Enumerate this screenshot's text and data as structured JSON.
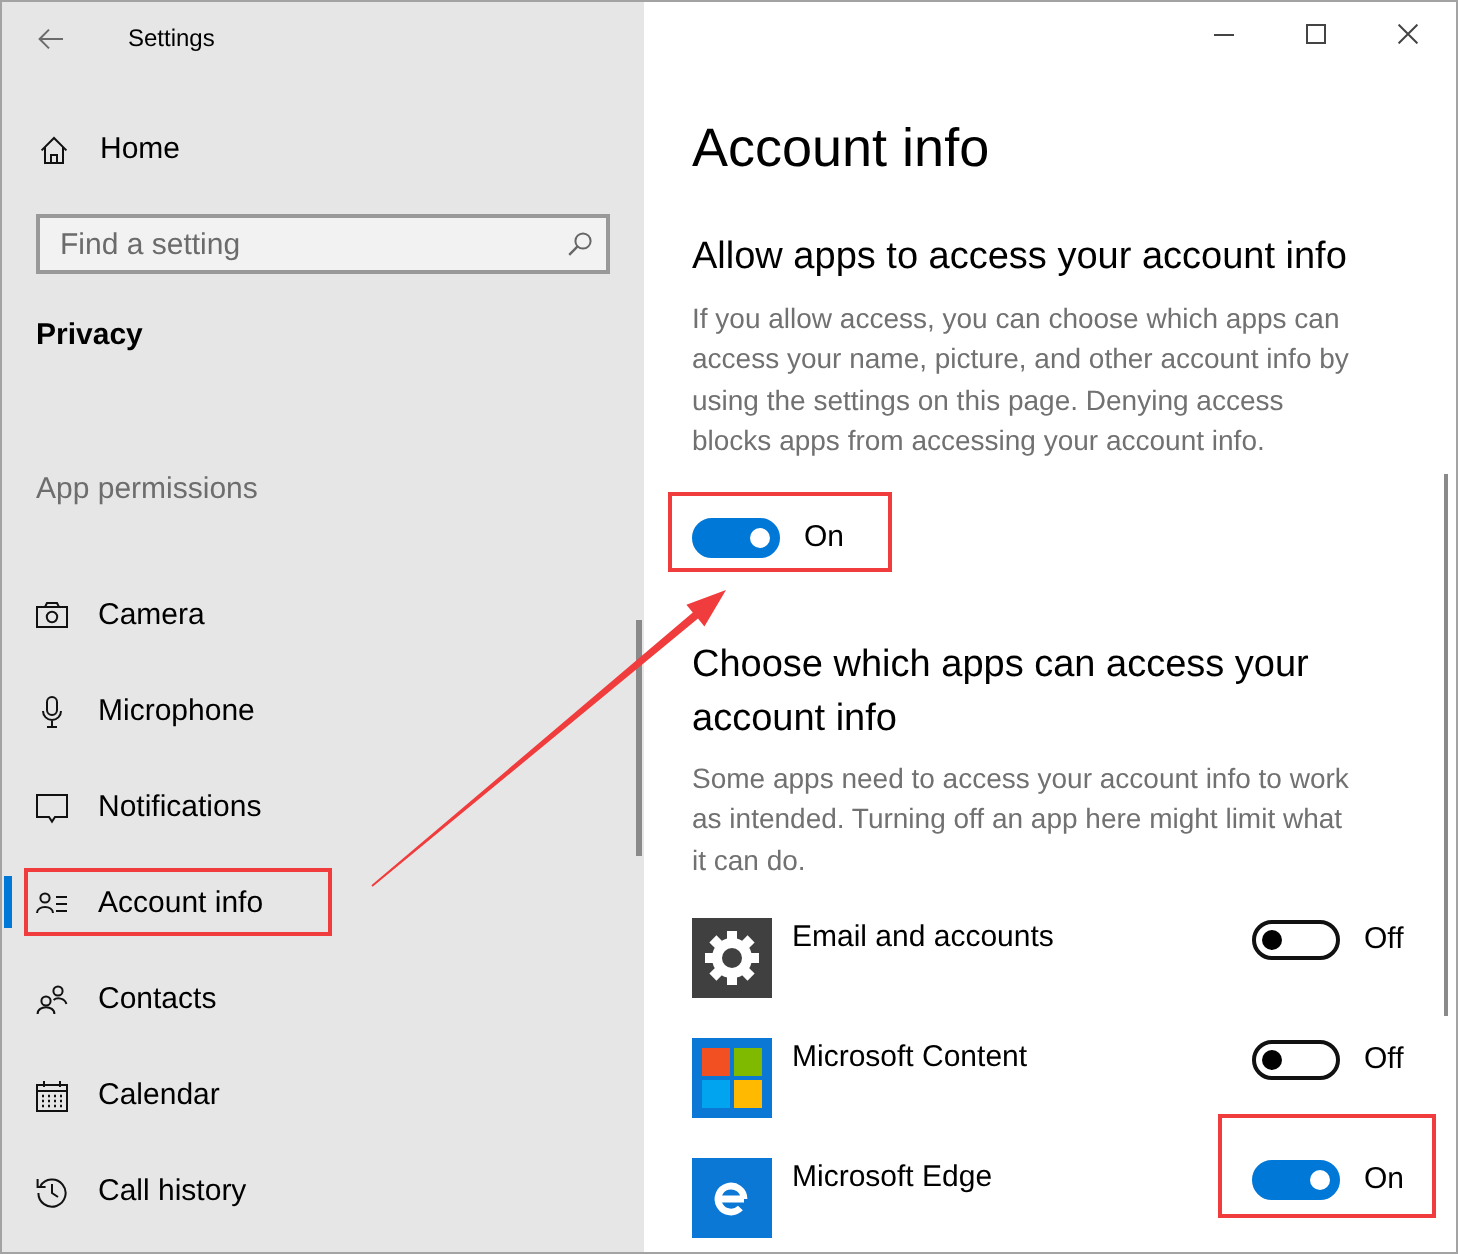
{
  "window": {
    "title": "Settings"
  },
  "sidebar": {
    "home": "Home",
    "search": {
      "placeholder": "Find a setting"
    },
    "section_title": "Privacy",
    "group_label": "App permissions",
    "items": [
      {
        "label": "Camera",
        "selected": false,
        "highlighted": false
      },
      {
        "label": "Microphone",
        "selected": false,
        "highlighted": false
      },
      {
        "label": "Notifications",
        "selected": false,
        "highlighted": false
      },
      {
        "label": "Account info",
        "selected": true,
        "highlighted": true
      },
      {
        "label": "Contacts",
        "selected": false,
        "highlighted": false
      },
      {
        "label": "Calendar",
        "selected": false,
        "highlighted": false
      },
      {
        "label": "Call history",
        "selected": false,
        "highlighted": false
      }
    ]
  },
  "content": {
    "title": "Account info",
    "master": {
      "heading": "Allow apps to access your account info",
      "description": "If you allow access, you can choose which apps can access your name, picture, and other account info by using the settings on this page. Denying access blocks apps from accessing your account info.",
      "toggle": {
        "on": true,
        "label": "On",
        "highlighted": true
      }
    },
    "apps": {
      "heading": "Choose which apps can access your account info",
      "description": "Some apps need to access your account info to work as intended. Turning off an app here might limit what it can do.",
      "items": [
        {
          "name": "Email and accounts",
          "on": false,
          "label": "Off",
          "highlighted": false
        },
        {
          "name": "Microsoft Content",
          "on": false,
          "label": "Off",
          "highlighted": false
        },
        {
          "name": "Microsoft Edge",
          "on": true,
          "label": "On",
          "highlighted": true
        }
      ]
    }
  }
}
